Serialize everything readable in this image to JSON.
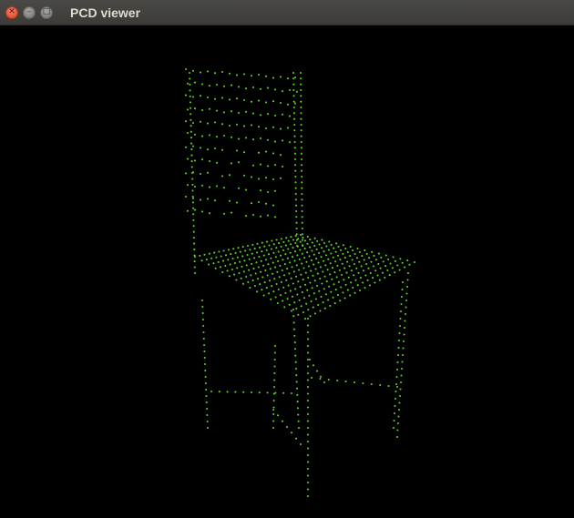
{
  "window": {
    "title": "PCD viewer",
    "controls": {
      "close_icon": "close-icon",
      "minimize_icon": "minimize-icon",
      "maximize_icon": "maximize-icon"
    }
  },
  "viewport": {
    "background_color": "#000000",
    "point_color": "#5fd02a",
    "object": "chair"
  }
}
